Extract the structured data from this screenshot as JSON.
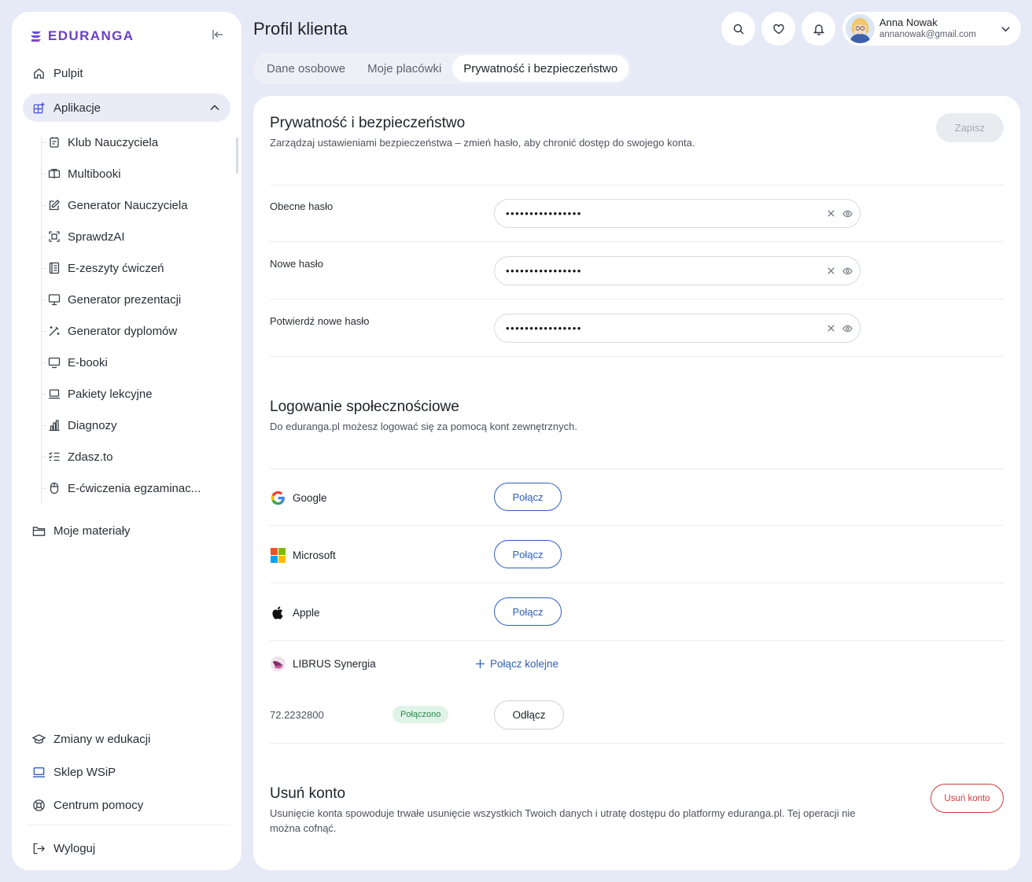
{
  "brand": {
    "name": "EDURANGA"
  },
  "sidebar": {
    "items": [
      {
        "label": "Pulpit",
        "icon": "home-icon"
      },
      {
        "label": "Aplikacje",
        "icon": "apps-icon"
      }
    ],
    "sub_items": [
      {
        "label": "Klub Nauczyciela",
        "icon": "club-icon"
      },
      {
        "label": "Multibooki",
        "icon": "book-icon"
      },
      {
        "label": "Generator Nauczyciela",
        "icon": "edit-icon"
      },
      {
        "label": "SprawdzAI",
        "icon": "scan-icon"
      },
      {
        "label": "E-zeszyty ćwiczeń",
        "icon": "notebook-icon"
      },
      {
        "label": "Generator prezentacji",
        "icon": "presentation-icon"
      },
      {
        "label": "Generator dyplomów",
        "icon": "magic-wand-icon"
      },
      {
        "label": "E-booki",
        "icon": "monitor-icon"
      },
      {
        "label": "Pakiety lekcyjne",
        "icon": "laptop-icon"
      },
      {
        "label": "Diagnozy",
        "icon": "bar-chart-icon"
      },
      {
        "label": "Zdasz.to",
        "icon": "checklist-icon"
      },
      {
        "label": "E-ćwiczenia egzaminac...",
        "icon": "mouse-icon"
      }
    ],
    "materials": {
      "label": "Moje materiały",
      "icon": "folder-icon"
    },
    "bottom": [
      {
        "label": "Zmiany w edukacji",
        "icon": "graduation-cap-icon"
      },
      {
        "label": "Sklep WSiP",
        "icon": "laptop-icon"
      },
      {
        "label": "Centrum pomocy",
        "icon": "lifebuoy-icon"
      },
      {
        "label": "Wyloguj",
        "icon": "logout-icon"
      }
    ]
  },
  "header": {
    "title": "Profil klienta",
    "tabs": [
      "Dane osobowe",
      "Moje placówki",
      "Prywatność i bezpieczeństwo"
    ],
    "active_tab": 2
  },
  "user": {
    "name": "Anna Nowak",
    "email": "annanowak@gmail.com"
  },
  "security": {
    "title": "Prywatność i bezpieczeństwo",
    "description": "Zarządzaj ustawieniami bezpieczeństwa – zmień hasło, aby chronić dostęp do swojego konta.",
    "save_label": "Zapisz",
    "fields": [
      {
        "label": "Obecne hasło",
        "value": "••••••••••••••••"
      },
      {
        "label": "Nowe hasło",
        "value": "••••••••••••••••"
      },
      {
        "label": "Potwierdź nowe hasło",
        "value": "••••••••••••••••"
      }
    ]
  },
  "social": {
    "title": "Logowanie społecznościowe",
    "description": "Do eduranga.pl możesz logować się za pomocą kont zewnętrznych.",
    "connect_label": "Połącz",
    "providers": [
      "Google",
      "Microsoft",
      "Apple"
    ],
    "librus": {
      "name": "LIBRUS Synergia",
      "connect_more": "Połącz kolejne",
      "account_id": "72.2232800",
      "status": "Połączono",
      "disconnect": "Odłącz"
    }
  },
  "delete": {
    "title": "Usuń konto",
    "description": "Usunięcie konta spowoduje trwałe usunięcie wszystkich Twoich danych i utratę dostępu do platformy eduranga.pl. Tej operacji nie można cofnąć.",
    "button": "Usuń konto"
  },
  "colors": {
    "accent": "#2e5fba",
    "brand": "#6b3fc9",
    "danger": "#d23b3b",
    "success": "#2c8a52"
  }
}
